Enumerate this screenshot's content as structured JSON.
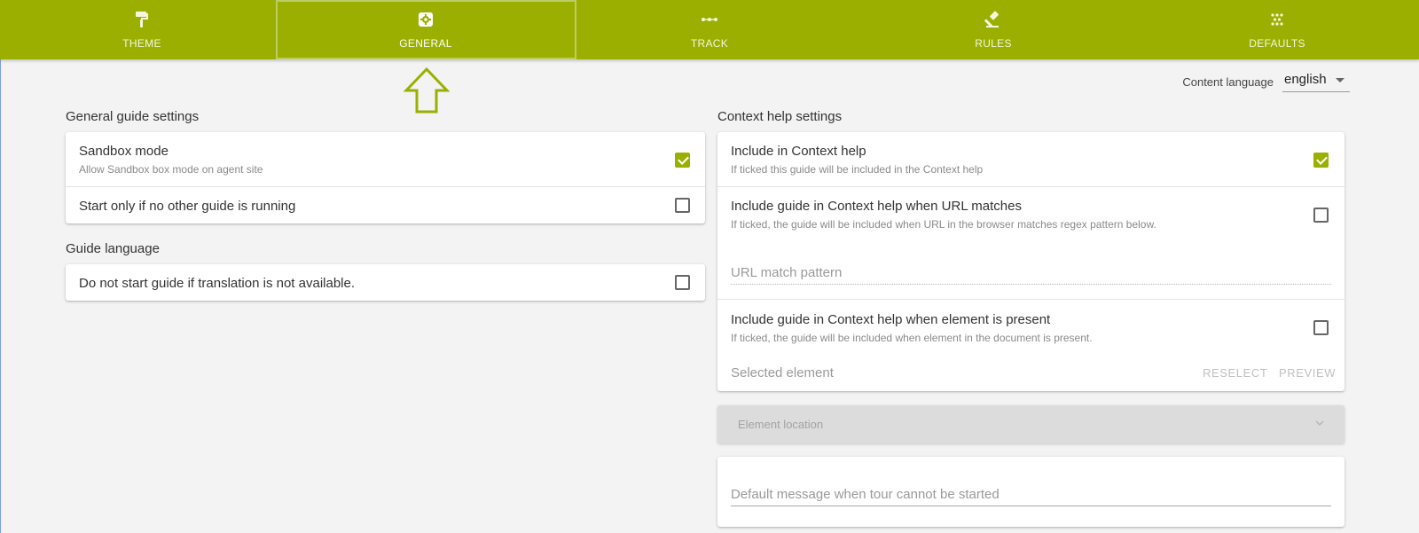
{
  "tabs": [
    {
      "label": "THEME",
      "icon": "paint-roller-icon"
    },
    {
      "label": "GENERAL",
      "icon": "settings-icon",
      "active": true
    },
    {
      "label": "TRACK",
      "icon": "track-icon"
    },
    {
      "label": "RULES",
      "icon": "gavel-icon"
    },
    {
      "label": "DEFAULTS",
      "icon": "dots-icon"
    }
  ],
  "colors": {
    "brand": "#9aaf00",
    "annotation": "#9aaf00"
  },
  "content_language": {
    "label": "Content language",
    "value": "english"
  },
  "general": {
    "title": "General guide settings",
    "sandbox": {
      "title": "Sandbox mode",
      "subtitle": "Allow Sandbox box mode on agent site",
      "checked": true
    },
    "start_only": {
      "title": "Start only if no other guide is running",
      "checked": false
    }
  },
  "language": {
    "title": "Guide language",
    "no_translation": {
      "title": "Do not start guide if translation is not available.",
      "checked": false
    }
  },
  "context": {
    "title": "Context help settings",
    "include": {
      "title": "Include in Context help",
      "subtitle": "If ticked this guide will be included in the Context help",
      "checked": true
    },
    "url_match": {
      "title": "Include guide in Context help when URL matches",
      "subtitle": "If ticked, the guide will be included when URL in the browser matches regex pattern below.",
      "checked": false,
      "placeholder": "URL match pattern"
    },
    "element": {
      "title": "Include guide in Context help when element is present",
      "subtitle": "If ticked, the guide will be included when element in the document is present.",
      "checked": false,
      "selected_label": "Selected element",
      "reselect": "RESELECT",
      "preview": "PREVIEW"
    },
    "element_location": {
      "label": "Element location"
    },
    "default_message": {
      "placeholder": "Default message when tour cannot be started"
    }
  }
}
